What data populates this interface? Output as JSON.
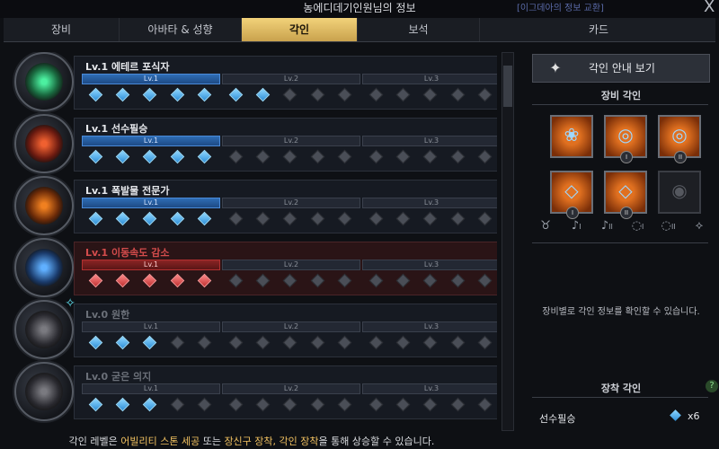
{
  "window": {
    "title": "농에디데기인원님의 정보",
    "top_right_link": "[이그데아의 정보 교환]",
    "close_label": "X"
  },
  "tabs": [
    {
      "label": "장비",
      "active": false
    },
    {
      "label": "아바타 & 성향",
      "active": false
    },
    {
      "label": "각인",
      "active": true
    },
    {
      "label": "보석",
      "active": false
    },
    {
      "label": "카드",
      "active": false
    }
  ],
  "engravings": [
    {
      "name": "Lv.1 에테르 포식자",
      "color": "blue",
      "lv_labels": [
        "Lv.1",
        "Lv.2",
        "Lv.3"
      ],
      "filled": 7,
      "state": "normal",
      "icon": "ether-predator-icon"
    },
    {
      "name": "Lv.1 선수필승",
      "color": "blue",
      "lv_labels": [
        "Lv.1",
        "Lv.2",
        "Lv.3"
      ],
      "filled": 5,
      "state": "normal",
      "icon": "preemptive-strike-icon"
    },
    {
      "name": "Lv.1 폭발물 전문가",
      "color": "blue",
      "lv_labels": [
        "Lv.1",
        "Lv.2",
        "Lv.3"
      ],
      "filled": 5,
      "state": "normal",
      "icon": "explosive-expert-icon"
    },
    {
      "name": "Lv.1 이동속도 감소",
      "color": "red",
      "lv_labels": [
        "Lv.1",
        "Lv.2",
        "Lv.3"
      ],
      "filled": 5,
      "state": "penalty",
      "icon": "move-speed-down-icon"
    },
    {
      "name": "Lv.0 원한",
      "color": "blue",
      "lv_labels": [
        "Lv.1",
        "Lv.2",
        "Lv.3"
      ],
      "filled": 3,
      "state": "dim",
      "icon": "grudge-icon"
    },
    {
      "name": "Lv.0 굳은 의지",
      "color": "blue",
      "lv_labels": [
        "Lv.1",
        "Lv.2",
        "Lv.3"
      ],
      "filled": 3,
      "state": "dim",
      "icon": "firm-will-icon"
    }
  ],
  "footer": {
    "prefix": "각인 레벨은 ",
    "highlight1": "어빌리티 스톤 세공",
    "mid": " 또는 ",
    "highlight2": "장신구 장착, 각인 장착",
    "suffix": "을 통해 상승할 수 있습니다."
  },
  "right_panel": {
    "guide_button": "각인 안내 보기",
    "equipment_title": "장비 각인",
    "slots": [
      {
        "icon": "necklace-icon",
        "sub": ""
      },
      {
        "icon": "earring-icon",
        "sub": "I"
      },
      {
        "icon": "earring-icon",
        "sub": "II"
      },
      {
        "icon": "ring-icon",
        "sub": "I"
      },
      {
        "icon": "ring-icon",
        "sub": "II"
      },
      {
        "icon": "ability-stone-icon",
        "sub": ""
      }
    ],
    "slot_labels": [
      {
        "icon": "necklace-slot-icon",
        "sub": ""
      },
      {
        "icon": "earring-slot-icon",
        "sub": "I"
      },
      {
        "icon": "earring-slot-icon",
        "sub": "II"
      },
      {
        "icon": "ring-slot-icon",
        "sub": "I"
      },
      {
        "icon": "ring-slot-icon",
        "sub": "II"
      },
      {
        "icon": "stone-slot-icon",
        "sub": ""
      }
    ],
    "hint": "장비별로 각인 정보를 확인할 수 있습니다.",
    "equipped_title": "장착 각인",
    "equipped": {
      "name": "선수필승",
      "count": "x6"
    },
    "help_label": "?"
  },
  "colors": {
    "accent_gold": "#f0c060",
    "tab_active": "#e0bb5e",
    "node_blue": "#4aa8f0",
    "node_red": "#d04040"
  }
}
